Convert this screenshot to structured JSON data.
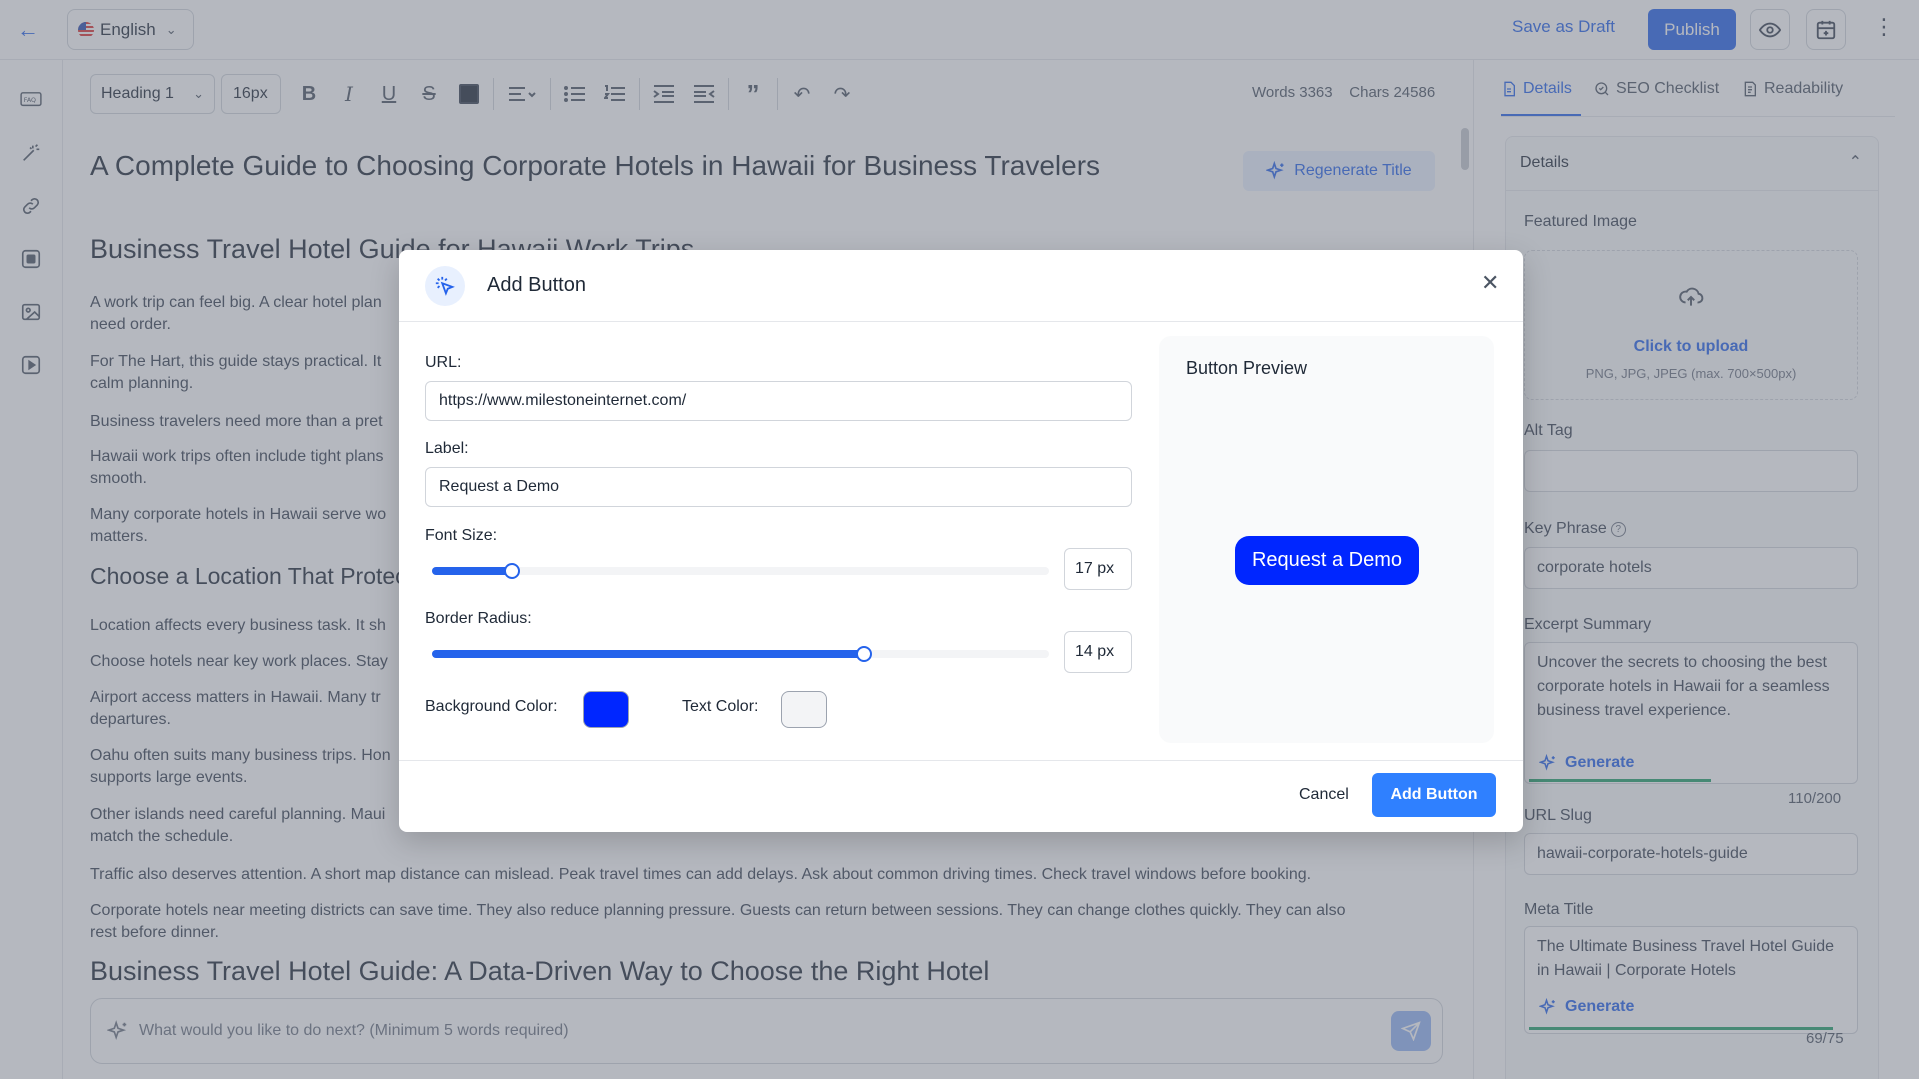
{
  "topbar": {
    "language": "English",
    "save_draft": "Save as Draft",
    "publish": "Publish"
  },
  "toolbar": {
    "heading": "Heading 1",
    "font_size": "16px",
    "words": "Words 3363",
    "chars": "Chars 24586"
  },
  "document": {
    "title": "A Complete Guide to Choosing Corporate Hotels in Hawaii for Business Travelers",
    "regenerate_title": "Regenerate Title",
    "h2_1": "Business Travel Hotel Guide for Hawaii Work Trips",
    "p1a": "A work trip can feel big. A clear hotel plan",
    "p1b": "need order.",
    "p2a": "For The Hart, this guide stays practical. It",
    "p2b": "calm planning.",
    "p3": "Business travelers need more than a pret",
    "p4a": "Hawaii work trips often include tight plans",
    "p4b": "smooth.",
    "p5a": "Many corporate hotels in Hawaii serve wo",
    "p5b": "matters.",
    "h3_1": "Choose a Location That Protects Your Schedule",
    "p6": "Location affects every business task. It sh",
    "p7": "Choose hotels near key work places. Stay",
    "p8a": "Airport access matters in Hawaii. Many tr",
    "p8b": "departures.",
    "p9a": "Oahu often suits many business trips. Hon",
    "p9b": "supports large events.",
    "p10a": "Other islands need careful planning. Maui",
    "p10b": "match the schedule.",
    "p11": "Traffic also deserves attention. A short map distance can mislead. Peak travel times can add delays. Ask about common driving times. Check travel windows before booking.",
    "p12a": "Corporate hotels near meeting districts can save time. They also reduce planning pressure. Guests can return between sessions. They can change clothes quickly. They can also",
    "p12b": "rest before dinner.",
    "h2_2": "Business Travel Hotel Guide: A Data-Driven Way to Choose the Right Hotel"
  },
  "chat": {
    "placeholder": "What would you like to do next? (Minimum 5 words required)"
  },
  "right_panel": {
    "tabs": [
      "Details",
      "SEO Checklist",
      "Readability"
    ],
    "details_title": "Details",
    "featured_image": "Featured Image",
    "click_to_upload": "Click to upload",
    "upload_hint": "PNG, JPG, JPEG (max. 700×500px)",
    "alt_tag": "Alt Tag",
    "key_phrase_label": "Key Phrase",
    "key_phrase_value": "corporate hotels",
    "excerpt_label": "Excerpt Summary",
    "excerpt_value": "Uncover the secrets to choosing the best corporate hotels in Hawaii for a seamless business travel experience.",
    "generate": "Generate",
    "excerpt_count": "110/200",
    "excerpt_progress": 0.55,
    "url_slug_label": "URL Slug",
    "url_slug_value": "hawaii-corporate-hotels-guide",
    "meta_title_label": "Meta Title",
    "meta_title_value": "The Ultimate Business Travel Hotel Guide in Hawaii | Corporate Hotels",
    "meta_title_count": "69/75",
    "meta_title_progress": 0.92
  },
  "modal": {
    "title": "Add Button",
    "url_label": "URL:",
    "url_value": "https://www.milestoneinternet.com/",
    "label_label": "Label:",
    "label_value": "Request a Demo",
    "font_size_label": "Font Size:",
    "font_size_value": "17 px",
    "font_size_fraction": 0.13,
    "border_radius_label": "Border Radius:",
    "border_radius_value": "14 px",
    "border_radius_fraction": 0.7,
    "bg_color_label": "Background Color:",
    "text_color_label": "Text Color:",
    "bg_color": "#0026ff",
    "text_color": "#f3f4f6",
    "preview_title": "Button Preview",
    "preview_button_text": "Request a Demo",
    "preview_text_color": "#ffffff",
    "cancel": "Cancel",
    "add": "Add Button"
  }
}
